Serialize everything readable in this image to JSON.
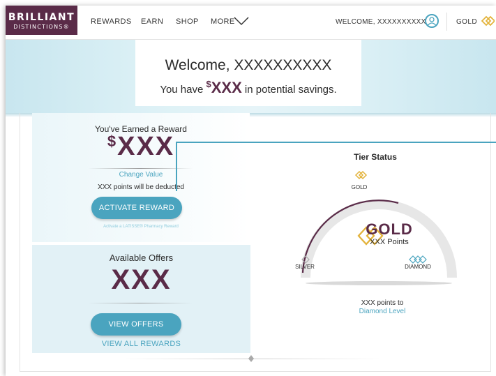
{
  "colors": {
    "brand": "#5a2b48",
    "accent": "#4aa4bf",
    "gold": "#e3b33c"
  },
  "nav": {
    "logo_line1": "BRILLIANT",
    "logo_line2": "DISTINCTIONS®",
    "links": [
      "REWARDS",
      "EARN",
      "SHOP",
      "MORE"
    ],
    "welcome": "WELCOME, XXXXXXXXXX",
    "tier_label": "GOLD"
  },
  "hero": {
    "greeting": "Welcome, XXXXXXXXXX",
    "savings_prefix": "You have ",
    "savings_currency": "$",
    "savings_amount": "XXX",
    "savings_suffix": " in potential savings."
  },
  "reward": {
    "title": "You've Earned a Reward",
    "currency": "$",
    "amount": "XXX",
    "change_link": "Change Value",
    "deduct_text": "XXX points will be deducted",
    "activate_button": "ACTIVATE REWARD",
    "faint_text": "Activate a LATISSE® Pharmacy Reward"
  },
  "offers": {
    "title": "Available Offers",
    "amount": "XXX",
    "view_button": "VIEW OFFERS",
    "view_all_link": "VIEW ALL REWARDS"
  },
  "tier": {
    "title": "Tier Status",
    "top_label": "GOLD",
    "current_tier": "GOLD",
    "points": "XXX Points",
    "left_label": "SILVER",
    "right_label": "DIAMOND",
    "to_next": "XXX points to",
    "next_level_link": "Diamond Level"
  },
  "icons": {
    "avatar": "user-circle-icon",
    "gold": "gold-diamond-icon",
    "more": "chevron-down-icon",
    "silver": "silver-diamond-icon",
    "diamond": "diamond-tier-icon"
  }
}
